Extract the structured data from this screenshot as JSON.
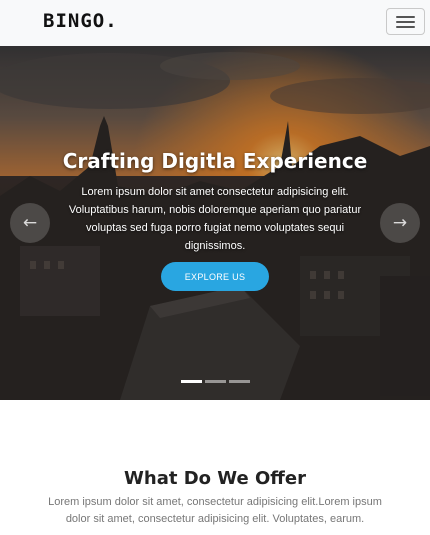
{
  "navbar": {
    "brand": "BINGO.",
    "toggler_icon": "hamburger-menu-icon"
  },
  "hero": {
    "title": "Crafting Digitla Experience",
    "text": "Lorem ipsum dolor sit amet consectetur adipisicing elit. Voluptatibus harum, nobis doloremque aperiam quo pariatur voluptas sed fuga porro fugiat nemo voluptates sequi dignissimos.",
    "button_label": "EXPLORE US",
    "prev_icon": "arrow-left-icon",
    "next_icon": "arrow-right-icon",
    "prev_glyph": "←",
    "next_glyph": "→",
    "slide_count": 3,
    "active_slide": 1,
    "accent_color": "#29a6e1"
  },
  "offer": {
    "title": "What Do We Offer",
    "text": "Lorem ipsum dolor sit amet, consectetur adipisicing elit.Lorem ipsum dolor sit amet, consectetur adipisicing elit. Voluptates, earum."
  }
}
